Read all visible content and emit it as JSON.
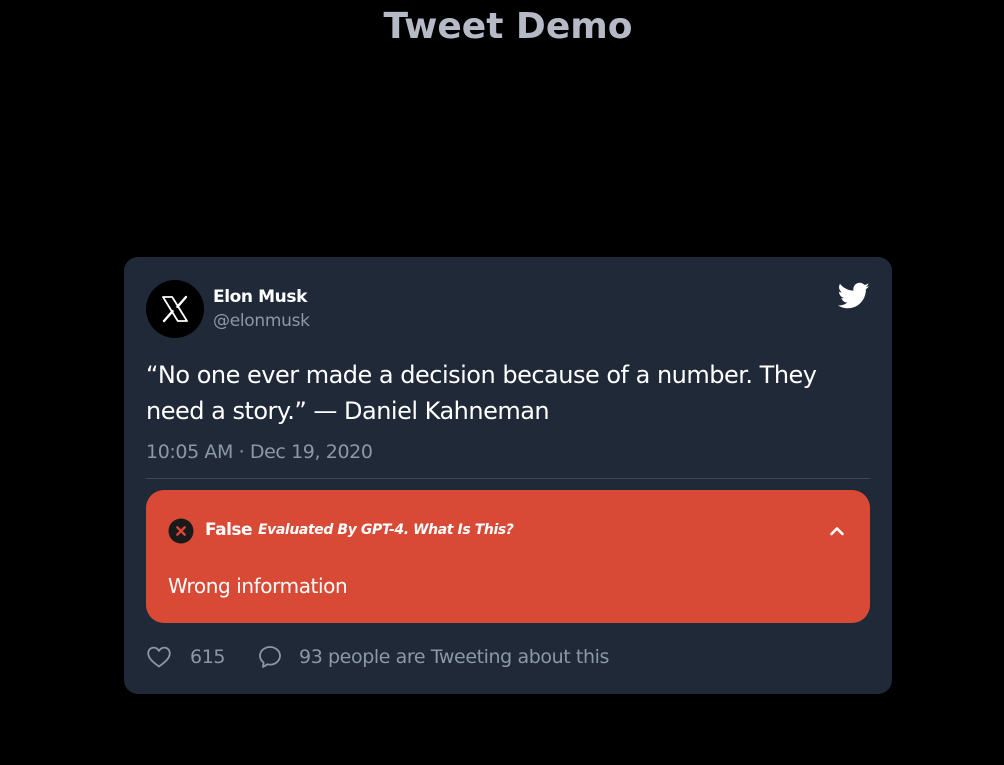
{
  "page": {
    "title": "Tweet Demo"
  },
  "tweet": {
    "author_name": "Elon Musk",
    "author_handle": "@elonmusk",
    "avatar_icon": "x-logo-icon",
    "brand_icon": "twitter-bird-icon",
    "text": "“No one ever made a decision because of a number. They need a story.” — Daniel Kahneman",
    "timestamp": "10:05 AM · Dec 19, 2020",
    "likes": "615",
    "replies_text": "93 people are Tweeting about this"
  },
  "fact_check": {
    "verdict": "False",
    "evaluated_by": "Evaluated By GPT-4. What Is This?",
    "detail": "Wrong information",
    "expanded": true,
    "color": "#d84a35"
  },
  "colors": {
    "background": "#000000",
    "card": "#202938",
    "muted_text": "#8b98a5",
    "title": "#b5bac6"
  }
}
